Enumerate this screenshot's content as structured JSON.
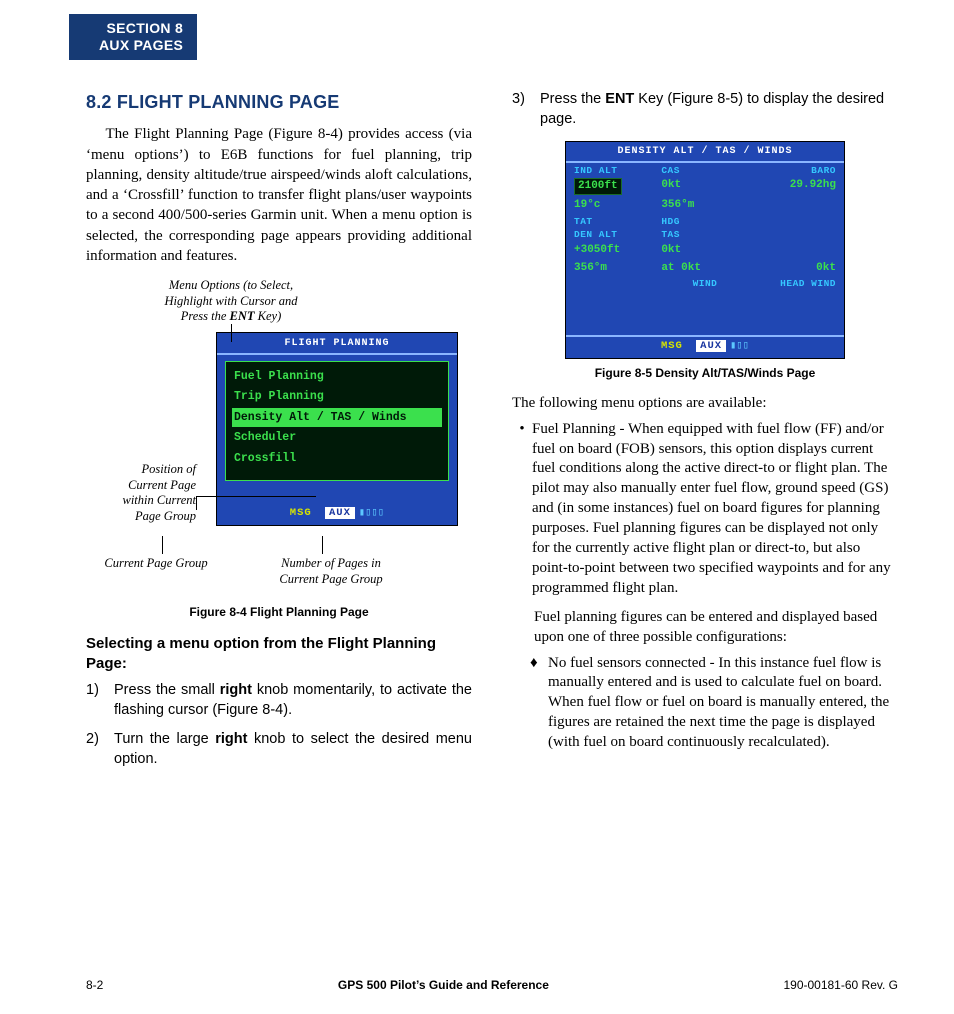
{
  "section_tab": {
    "line1": "SECTION 8",
    "line2": "AUX PAGES"
  },
  "left": {
    "heading": "8.2  FLIGHT PLANNING PAGE",
    "intro": "The Flight Planning Page (Figure 8-4) provides access (via ‘menu options’) to E6B functions for fuel planning, trip planning, density altitude/true airspeed/winds aloft calculations, and a ‘Crossfill’ function to transfer flight plans/user waypoints to a second 400/500-series Garmin unit.  When a menu option is selected, the corresponding page appears providing additional information and features.",
    "annot_menu_options_l1": "Menu Options (to Select,",
    "annot_menu_options_l2": "Highlight with Cursor and",
    "annot_menu_options_l3": "Press the ",
    "annot_menu_options_l3b": "ENT",
    "annot_menu_options_l3c": " Key)",
    "annot_position_l1": "Position of",
    "annot_position_l2": "Current Page",
    "annot_position_l3": "within Current",
    "annot_position_l4": "Page Group",
    "annot_current_group": "Current Page Group",
    "annot_numpages_l1": "Number of Pages in",
    "annot_numpages_l2": "Current Page Group",
    "fig84": {
      "title": "FLIGHT PLANNING",
      "items": [
        "Fuel Planning",
        "Trip Planning",
        "Density Alt / TAS / Winds",
        "Scheduler",
        "Crossfill"
      ],
      "selected_index": 2,
      "msg": "MSG",
      "aux": "AUX",
      "bars": "▮▯▯▯"
    },
    "fig84_caption": "Figure 8-4  Flight Planning Page",
    "subheading": "Selecting a menu option from the Flight Planning Page:",
    "step1_a": "Press the small ",
    "step1_b": "right",
    "step1_c": " knob momentarily, to activate the flashing cursor (Figure 8-4).",
    "step2_a": "Turn the large ",
    "step2_b": "right",
    "step2_c": " knob to select the desired menu option."
  },
  "right": {
    "step3_a": "Press the ",
    "step3_b": "ENT",
    "step3_c": " Key (Figure 8-5) to display the desired page.",
    "fig85": {
      "title": "DENSITY ALT / TAS / WINDS",
      "hdr1": [
        "IND ALT",
        "CAS",
        "BARO"
      ],
      "row1": [
        "2100ft",
        "0kt",
        "29.92hg"
      ],
      "row1b": [
        "19°c",
        "356°m",
        ""
      ],
      "hdr2": [
        "TAT",
        "HDG",
        ""
      ],
      "hdr3": [
        "DEN ALT",
        "TAS",
        ""
      ],
      "row3": [
        "+3050ft",
        "0kt",
        ""
      ],
      "row4": [
        "356°m",
        "at   0kt",
        "0kt"
      ],
      "hdr4": [
        "",
        "WIND",
        "HEAD WIND"
      ],
      "msg": "MSG",
      "aux": "AUX",
      "bars": "▮▯▯"
    },
    "fig85_caption": "Figure 8-5  Density Alt/TAS/Winds Page",
    "para_following": "The following menu options are available:",
    "bullet1": "Fuel Planning - When equipped with fuel flow (FF) and/or fuel on board (FOB) sensors, this option displays current fuel conditions along the active direct-to or flight plan.  The pilot may also manually enter fuel flow, ground speed (GS) and (in some instances) fuel on board figures for planning purposes.  Fuel planning figures can be displayed not only for the currently active flight plan or direct-to, but also point-to-point between two specified waypoints and for any programmed flight plan.",
    "para_config": "Fuel planning figures can be entered and displayed based upon one of three possible configurations:",
    "diam1": "No fuel sensors connected - In this instance fuel flow is manually entered and is used to calculate fuel on board.  When fuel flow or fuel on board is manually entered, the figures are retained the next time the page is displayed (with fuel on board continuously recalculated)."
  },
  "footer": {
    "page": "8-2",
    "title": "GPS 500 Pilot’s Guide and Reference",
    "rev": "190-00181-60  Rev. G"
  }
}
